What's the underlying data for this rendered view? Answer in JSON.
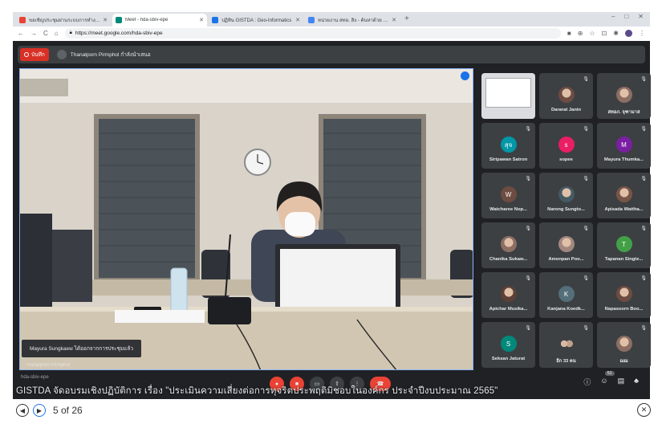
{
  "browser": {
    "tabs": [
      {
        "title": "ขอเชิญประชุมผ่านระบบการทำงาน",
        "active": false,
        "color": "#ea4335"
      },
      {
        "title": "Meet - hda-sbiv-epe",
        "active": true,
        "color": "#00897b"
      },
      {
        "title": "ปฏิทิน GISTDA : Geo-Informatics",
        "active": false,
        "color": "#1a73e8"
      },
      {
        "title": "หน่วยงาน สทอ. สิง - ค้นหาด้วย Google",
        "active": false,
        "color": "#4285f4"
      }
    ],
    "new_tab": "+",
    "url": "https://meet.google.com/hda-sbiv-epe"
  },
  "meet": {
    "record_label": "บันทึก",
    "presenter_label": "Thanatporn Pirmphol กำลังนำเสนอ",
    "notification": "Mayura Sungkaew ได้ออกจากการประชุมแล้ว",
    "stage_name": "Thanatporn Pirmphol",
    "meeting_code": "hda-sbiv-epe",
    "participants": [
      {
        "name": "",
        "type": "screen"
      },
      {
        "name": "Dararat Janin",
        "type": "photo",
        "color": "#6d4c41"
      },
      {
        "name": "สทอภ. จุฑามาส",
        "type": "photo",
        "color": "#8d6e63"
      },
      {
        "name": "Siripawan Satron",
        "type": "letter",
        "letter": "สุจ",
        "color": "#0097a7"
      },
      {
        "name": "sopee",
        "type": "letter",
        "letter": "s",
        "color": "#e91e63"
      },
      {
        "name": "Mayura Thumka...",
        "type": "letter",
        "letter": "M",
        "color": "#7b1fa2"
      },
      {
        "name": "Watcharee Nop...",
        "type": "letter",
        "letter": "W",
        "color": "#6d4c41"
      },
      {
        "name": "Narong Sungto...",
        "type": "photo",
        "color": "#455a64"
      },
      {
        "name": "Apisada Wattha...",
        "type": "photo",
        "color": "#795548"
      },
      {
        "name": "Chanika Sukaw...",
        "type": "photo",
        "color": "#8d6e63"
      },
      {
        "name": "Amonpan Poo...",
        "type": "photo",
        "color": "#a1887f"
      },
      {
        "name": "Tapanan Singte...",
        "type": "letter",
        "letter": "T",
        "color": "#43a047"
      },
      {
        "name": "Apichar Musika...",
        "type": "photo",
        "color": "#5d4037"
      },
      {
        "name": "Kanjana Koedk...",
        "type": "letter",
        "letter": "K",
        "color": "#546e7a"
      },
      {
        "name": "Napassorn Boo...",
        "type": "photo",
        "color": "#6d4c41"
      },
      {
        "name": "Seksan Jaturat",
        "type": "letter",
        "letter": "S",
        "color": "#00897b"
      },
      {
        "name": "อีก 33 คน",
        "type": "more",
        "color": "#5f6368"
      },
      {
        "name": "ฌฌ",
        "type": "photo",
        "color": "#8d6e63"
      }
    ],
    "participant_count": "51"
  },
  "caption": "GISTDA จัดอบรมเชิงปฏิบัติการ เรื่อง \"ประเมินความเสี่ยงต่อการทุจริตประพฤติมิชอบในองค์กร ประจำปีงบประมาณ 2565\"",
  "viewer": {
    "page_label": "5 of 26"
  }
}
